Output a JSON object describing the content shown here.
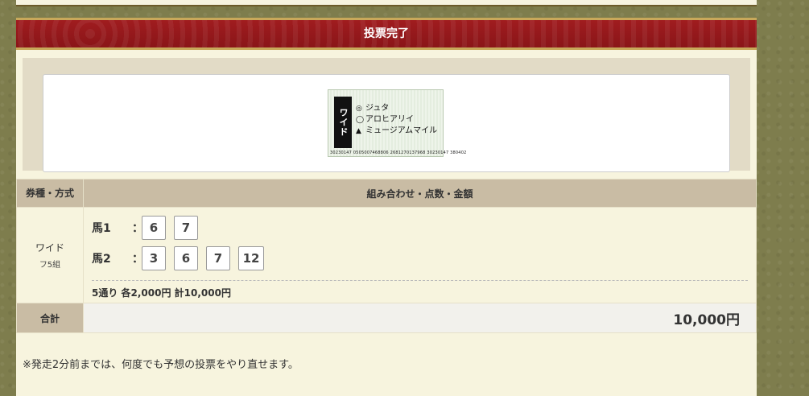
{
  "header": {
    "title": "投票完了"
  },
  "ticket": {
    "type": "ワイド",
    "horses": [
      {
        "mark": "◎",
        "name": "ジュタ"
      },
      {
        "mark": "◯",
        "name": "アロヒアリイ"
      },
      {
        "mark": "▲",
        "name": "ミュージアムマイル"
      }
    ],
    "serial": "30230147 0505007468806 2681270137968 30230147 380402"
  },
  "table": {
    "col_type_header": "券種・方式",
    "col_combo_header": "組み合わせ・点数・金額",
    "bet_type": "ワイド",
    "bet_method": "フ5組",
    "horse1_label": "馬1",
    "horse2_label": "馬2",
    "colon": "：",
    "horse1_numbers": [
      "6",
      "7"
    ],
    "horse2_numbers": [
      "3",
      "6",
      "7",
      "12"
    ],
    "summary": "5通り 各2,000円 計10,000円",
    "total_label": "合計",
    "total_value": "10,000円"
  },
  "note": "※発走2分前までは、何度でも予想の投票をやり直せます。"
}
